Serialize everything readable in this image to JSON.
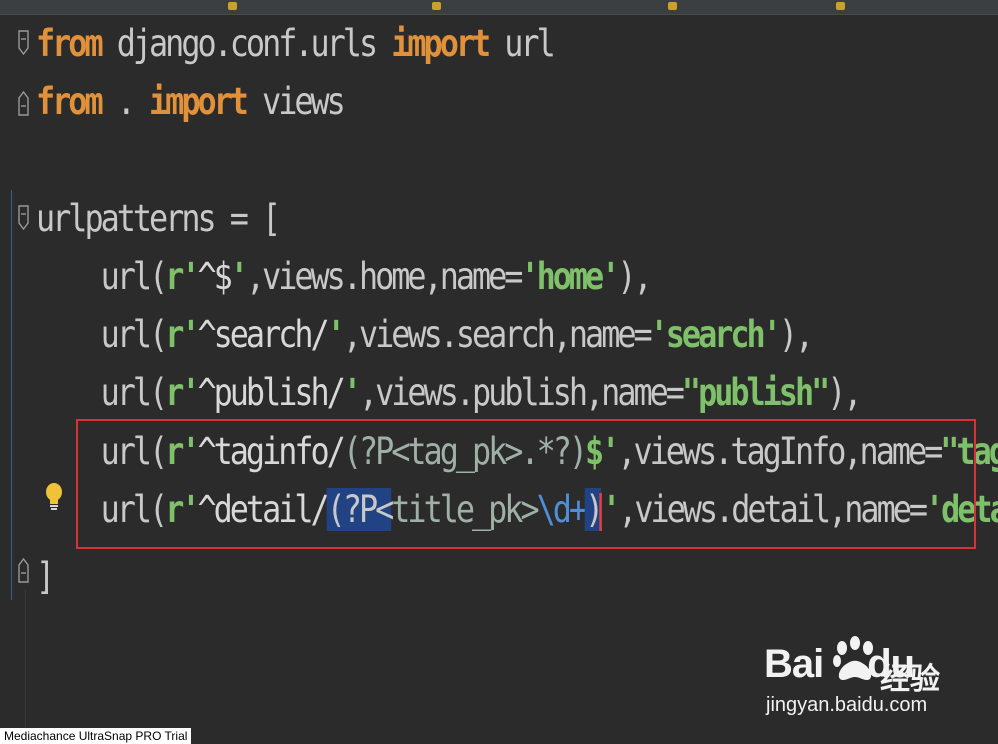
{
  "tab_bar": {
    "accent_color": "#c9a227"
  },
  "code": {
    "line1": {
      "kw1": "from",
      "mod": " django.conf.urls ",
      "kw2": "import",
      "name": " url"
    },
    "line2": {
      "kw1": "from",
      "mod": " . ",
      "kw2": "import",
      "name": " views"
    },
    "line3": {
      "text": "urlpatterns = ["
    },
    "line4": {
      "indent": "    ",
      "fn": "url(",
      "pre": "r'",
      "rx": "^$",
      "q": "'",
      "rest1": ",views.home,name=",
      "name": "'home'",
      "close": "),"
    },
    "line5": {
      "indent": "    ",
      "fn": "url(",
      "pre": "r'",
      "rx": "^search/",
      "q": "'",
      "rest1": ",views.search,name=",
      "name": "'search'",
      "close": "),"
    },
    "line6": {
      "indent": "    ",
      "fn": "url(",
      "pre": "r'",
      "rx": "^publish/",
      "q": "'",
      "rest1": ",views.publish,name=",
      "name": "\"publish\"",
      "close": "),"
    },
    "line7": {
      "indent": "    ",
      "fn": "url(",
      "pre": "r'",
      "rx": "^taginfo/",
      "grp": "(?P<tag_pk>.*?)",
      "end": "$",
      "q": "'",
      "rest1": ",views.tagInfo,name=",
      "name": "\"taginfo\"",
      "close": "),"
    },
    "line8": {
      "indent": "    ",
      "fn": "url(",
      "pre": "r'",
      "rx": "^detail/",
      "sel": "(?P<",
      "grp": "title_pk>",
      "esc": "\\d+",
      "paren": ")",
      "q": "'",
      "rest1": ",views.detail,name=",
      "name": "'detail'",
      "close": "),"
    },
    "line9": {
      "text": "]"
    }
  },
  "colors": {
    "keyword": "#e0913a",
    "string": "#7ec16a",
    "selection": "#214283",
    "highlight_box": "#d9313a",
    "background": "#2b2b2b"
  },
  "watermark": {
    "text": "Mediachance UltraSnap PRO Trial"
  },
  "baidu": {
    "brand": "Bai",
    "brand2": "du",
    "cn": "经验",
    "url": "jingyan.baidu.com"
  }
}
